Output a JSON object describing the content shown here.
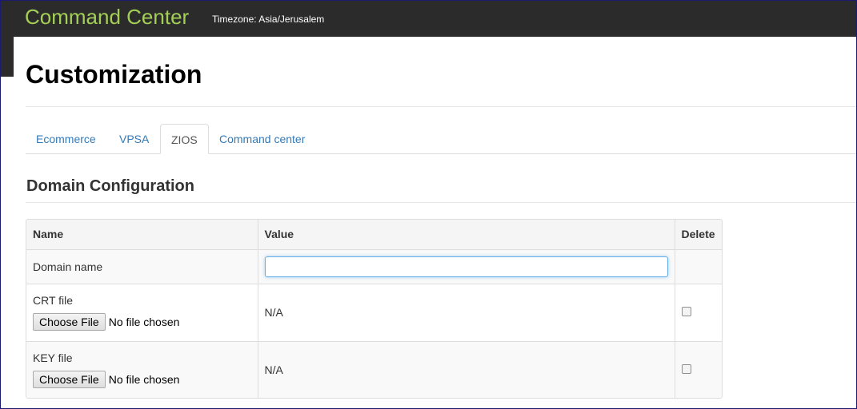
{
  "navbar": {
    "brand": "Command Center",
    "timezone": "Timezone: Asia/Jerusalem"
  },
  "page": {
    "title": "Customization"
  },
  "tabs": [
    {
      "label": "Ecommerce",
      "active": false
    },
    {
      "label": "VPSA",
      "active": false
    },
    {
      "label": "ZIOS",
      "active": true
    },
    {
      "label": "Command center",
      "active": false
    }
  ],
  "section": {
    "title": "Domain Configuration"
  },
  "table": {
    "headers": {
      "name": "Name",
      "value": "Value",
      "delete": "Delete"
    },
    "rows": {
      "domain": {
        "name": "Domain name",
        "value": ""
      },
      "crt": {
        "name": "CRT file",
        "button": "Choose File",
        "status": "No file chosen",
        "value": "N/A",
        "checked": false
      },
      "key": {
        "name": "KEY file",
        "button": "Choose File",
        "status": "No file chosen",
        "value": "N/A",
        "checked": false
      }
    }
  },
  "colors": {
    "brand": "#a4cf56",
    "navbar_bg": "#2b2b2b",
    "link": "#337ab7"
  }
}
